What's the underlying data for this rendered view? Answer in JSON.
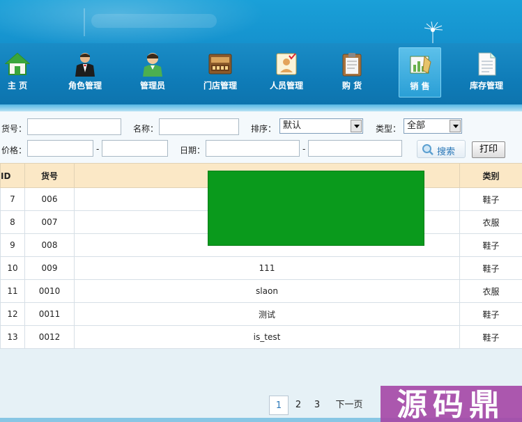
{
  "nav": {
    "items": [
      {
        "label": "主 页",
        "icon": "home-icon"
      },
      {
        "label": "角色管理",
        "icon": "butler-icon"
      },
      {
        "label": "管理员",
        "icon": "admin-person-icon"
      },
      {
        "label": "门店管理",
        "icon": "store-icon"
      },
      {
        "label": "人员管理",
        "icon": "staff-card-icon"
      },
      {
        "label": "购 货",
        "icon": "clipboard-icon"
      },
      {
        "label": "销 售",
        "icon": "sales-icon"
      },
      {
        "label": "库存管理",
        "icon": "document-icon"
      }
    ],
    "active_index": 6
  },
  "search": {
    "code_label": "货号：",
    "name_label": "名称：",
    "sort_label": "排序：",
    "sort_value": "默认",
    "type_label": "类型：",
    "type_value": "全部",
    "price_label": "价格：",
    "range_sep1": "-",
    "date_label": "日期：",
    "range_sep2": "-",
    "search_button": "搜索",
    "print_button": "打印"
  },
  "table": {
    "headers": {
      "id": "品ID",
      "code": "货号",
      "name": "",
      "type": "类别"
    },
    "rows": [
      {
        "id": "7",
        "code": "006",
        "name": "",
        "type": "鞋子"
      },
      {
        "id": "8",
        "code": "007",
        "name": "",
        "type": "衣服"
      },
      {
        "id": "9",
        "code": "008",
        "name": "",
        "type": "鞋子"
      },
      {
        "id": "10",
        "code": "009",
        "name": "111",
        "type": "鞋子"
      },
      {
        "id": "11",
        "code": "0010",
        "name": "slaon",
        "type": "衣服"
      },
      {
        "id": "12",
        "code": "0011",
        "name": "测试",
        "type": "鞋子"
      },
      {
        "id": "13",
        "code": "0012",
        "name": "is_test",
        "type": "鞋子"
      }
    ]
  },
  "pagination": {
    "pages": [
      "1",
      "2",
      "3"
    ],
    "current": "1",
    "next_label": "下一页"
  },
  "watermark": {
    "text": "源码鼎"
  },
  "colors": {
    "header_blue": "#1592ce",
    "nav_blue": "#0f7cb8",
    "table_header": "#fbe8c6",
    "mask_green": "#0a9a1c",
    "watermark_purple": "#a64aa8"
  }
}
